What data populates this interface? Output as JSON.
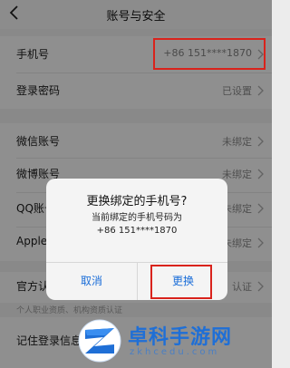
{
  "nav": {
    "title": "账号与安全",
    "back_icon": "chevron-left-icon"
  },
  "rows": [
    {
      "label": "手机号",
      "value": "+86 151****1870"
    },
    {
      "label": "登录密码",
      "value": "已设置"
    },
    {
      "label": "微信账号",
      "value": "未绑定"
    },
    {
      "label": "微博账号",
      "value": "未绑定"
    },
    {
      "label": "QQ账号",
      "value": "未绑定"
    },
    {
      "label": "Apple",
      "value": "未绑定"
    },
    {
      "label": "官方认证",
      "value": "认证"
    },
    {
      "label": "记住登录信息",
      "value": ""
    }
  ],
  "caption": "个人职业资质、机构资质认证",
  "dialog": {
    "title": "更换绑定的手机号?",
    "message_line1": "当前绑定的手机号码为",
    "message_line2": "+86 151****1870",
    "cancel_label": "取消",
    "confirm_label": "更换"
  },
  "watermark": {
    "title": "卓科手游网",
    "domain": "zkhcedu.com"
  },
  "colors": {
    "highlight": "#d9231c",
    "link": "#1a6dd8",
    "watermark_blue": "#1f6fd6"
  }
}
